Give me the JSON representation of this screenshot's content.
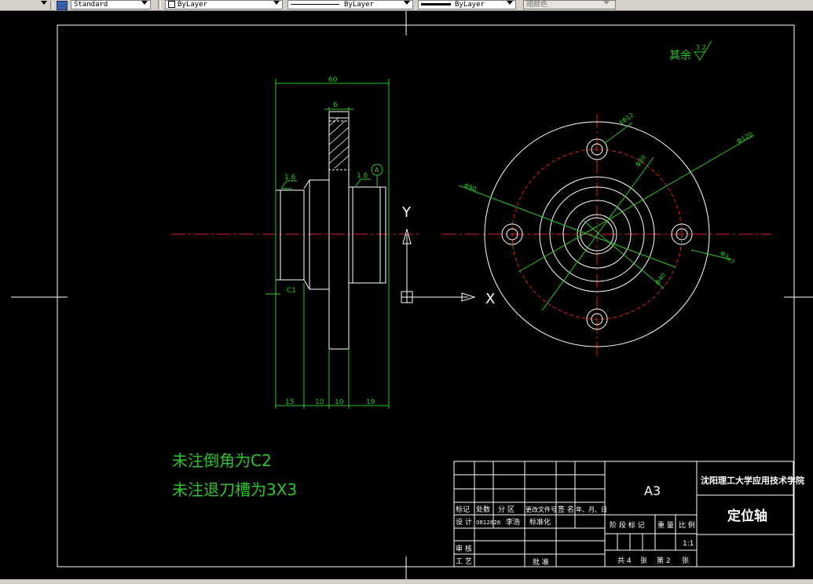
{
  "toolbar": {
    "text_style": "Standard",
    "layer": "ByLayer",
    "linetype": "ByLayer",
    "lineweight": "ByLayer",
    "color": "随颜色"
  },
  "drawing": {
    "roughness_other": "其余",
    "roughness_other_value": "3.2",
    "notes": [
      "未注倒角为C2",
      "未注退刀槽为3X3"
    ],
    "ucs": {
      "x": "X",
      "y": "Y"
    },
    "dims_side": {
      "total": "60",
      "flange": "6",
      "rough_left": "1.6",
      "rough_right": "1.6",
      "datum": "A",
      "chamfer": "C1",
      "seg1": "15",
      "seg2": "10",
      "seg3": "10",
      "seg4": "19"
    },
    "dims_front": {
      "hole": "4Φ12",
      "pcd": "Φ80",
      "outer": "Φ120",
      "d1": "Φ90",
      "d2": "Φ40",
      "d3": "Φ3e7"
    }
  },
  "title_block": {
    "sheet": "A3",
    "school": "沈阳理工大学应用技术学院",
    "part": "定位轴",
    "hdr": [
      "标记",
      "处数",
      "分 区",
      "更改文件号",
      "签 名",
      "年、月、日"
    ],
    "design_row": [
      "设 计",
      "0812626",
      "李浩",
      "标准化"
    ],
    "audit": "审 核",
    "craft": "工 艺",
    "approve": "批 准",
    "stage_hdr": [
      "阶 段 标 记",
      "重 量",
      "比 例"
    ],
    "scale": "1:1",
    "sheets": [
      "共 4",
      "张",
      "第 2",
      "张"
    ]
  }
}
